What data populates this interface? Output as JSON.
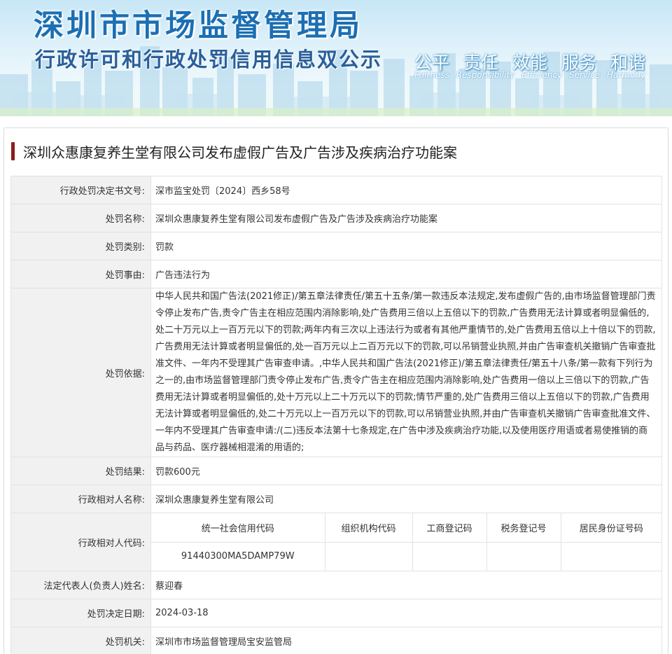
{
  "banner": {
    "title": "深圳市市场监督管理局",
    "subtitle": "行政许可和行政处罚信用信息双公示",
    "slogans_cn": [
      "公平",
      "责任",
      "效能",
      "服务",
      "和谐"
    ],
    "slogans_en": [
      "Fairness",
      "Responsibility",
      "Efficiency",
      "Service",
      "Harmony"
    ]
  },
  "case": {
    "title": "深圳众惠康复养生堂有限公司发布虚假广告及广告涉及疾病治疗功能案"
  },
  "fields": {
    "doc_no": {
      "label": "行政处罚决定书文号:",
      "value": "深市监宝处罚〔2024〕西乡58号"
    },
    "penalty_name": {
      "label": "处罚名称:",
      "value": "深圳众惠康复养生堂有限公司发布虚假广告及广告涉及疾病治疗功能案"
    },
    "penalty_type": {
      "label": "处罚类别:",
      "value": "罚款"
    },
    "penalty_reason": {
      "label": "处罚事由:",
      "value": "广告违法行为"
    },
    "penalty_basis": {
      "label": "处罚依据:",
      "value": "中华人民共和国广告法(2021修正)/第五章法律责任/第五十五条/第一款违反本法规定,发布虚假广告的,由市场监督管理部门责令停止发布广告,责令广告主在相应范围内消除影响,处广告费用三倍以上五倍以下的罚款,广告费用无法计算或者明显偏低的,处二十万元以上一百万元以下的罚款;两年内有三次以上违法行为或者有其他严重情节的,处广告费用五倍以上十倍以下的罚款,广告费用无法计算或者明显偏低的,处一百万元以上二百万元以下的罚款,可以吊销营业执照,并由广告审查机关撤销广告审查批准文件、一年内不受理其广告审查申请。,中华人民共和国广告法(2021修正)/第五章法律责任/第五十八条/第一款有下列行为之一的,由市场监督管理部门责令停止发布广告,责令广告主在相应范围内消除影响,处广告费用一倍以上三倍以下的罚款,广告费用无法计算或者明显偏低的,处十万元以上二十万元以下的罚款;情节严重的,处广告费用三倍以上五倍以下的罚款,广告费用无法计算或者明显偏低的,处二十万元以上一百万元以下的罚款,可以吊销营业执照,并由广告审查机关撤销广告审查批准文件、一年内不受理其广告审查申请:/(二)违反本法第十七条规定,在广告中涉及疾病治疗功能,以及使用医疗用语或者易使推销的商品与药品、医疗器械相混淆的用语的;"
    },
    "penalty_result": {
      "label": "处罚结果:",
      "value": "罚款600元"
    },
    "party_name": {
      "label": "行政相对人名称:",
      "value": "深圳众惠康复养生堂有限公司"
    },
    "party_code": {
      "label": "行政相对人代码:",
      "headers": [
        "统一社会信用代码",
        "组织机构代码",
        "工商登记码",
        "税务登记号",
        "居民身份证号码"
      ],
      "values": [
        "91440300MA5DAMP79W",
        "",
        "",
        "",
        ""
      ]
    },
    "legal_rep": {
      "label": "法定代表人(负责人)姓名:",
      "value": "蔡迎春"
    },
    "decision_date": {
      "label": "处罚决定日期:",
      "value": "2024-03-18"
    },
    "authority": {
      "label": "处罚机关:",
      "value": "深圳市市场监督管理局宝安监管局"
    }
  },
  "colors": {
    "title_blue": "#1b6fb3",
    "title_bar": "#8b1d1d",
    "label_bg": "#f1f1f1",
    "border": "#e2e2e2"
  }
}
